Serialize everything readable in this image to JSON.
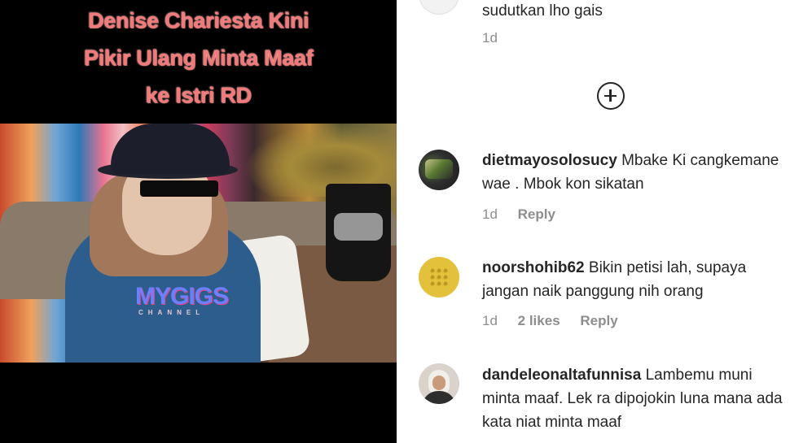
{
  "video": {
    "caption": {
      "line1": "Denise Chariesta Kini",
      "line2": "Pikir Ulang Minta Maaf",
      "line3": "ke Istri RD"
    },
    "watermark": {
      "brand": "MYGIGS",
      "sub": "CHANNEL"
    }
  },
  "comments": {
    "top_partial": {
      "text": "sudutkan lho gais",
      "time": "1d"
    },
    "load_more_icon": "plus-circle-icon",
    "items": [
      {
        "username": "dietmayosolosucy",
        "text": "Mbake Ki cangkemane wae . Mbok kon sikatan",
        "time": "1d",
        "likes": "",
        "reply_label": "Reply"
      },
      {
        "username": "noorshohib62",
        "text": "Bikin petisi lah, supaya jangan naik panggung nih orang",
        "time": "1d",
        "likes": "2 likes",
        "reply_label": "Reply"
      },
      {
        "username": "dandeleonaltafunnisa",
        "text": "Lambemu muni minta maaf. Lek ra dipojokin luna mana ada kata niat minta maaf",
        "time": "",
        "likes": "",
        "reply_label": ""
      }
    ]
  }
}
